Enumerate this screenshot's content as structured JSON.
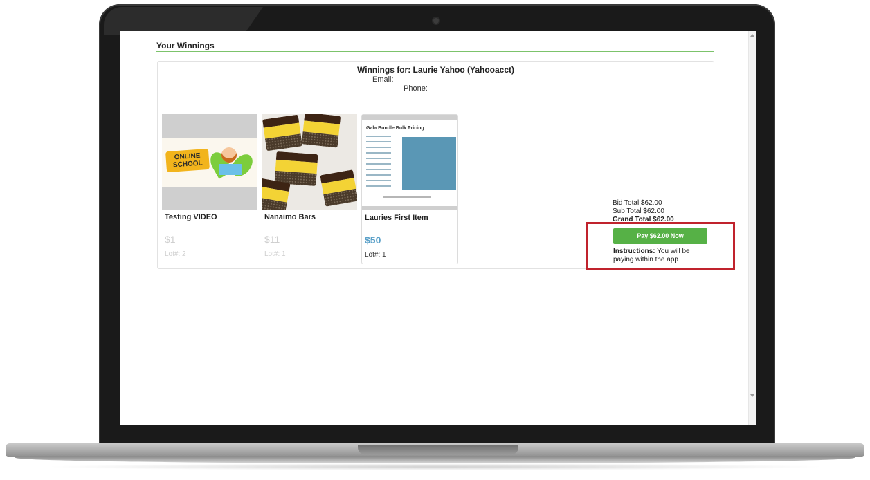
{
  "page": {
    "section_title": "Your Winnings",
    "winner_heading": "Winnings for: Laurie Yahoo (Yahooacct)",
    "email_label": "Email:",
    "phone_label": "Phone:"
  },
  "items": [
    {
      "title": "Testing VIDEO",
      "price": "$1",
      "lot": "Lot#: 2",
      "state": "faded",
      "thumb": "online-school"
    },
    {
      "title": "Nanaimo Bars",
      "price": "$11",
      "lot": "Lot#: 1",
      "state": "faded",
      "thumb": "nanaimo-bars"
    },
    {
      "title": "Lauries First Item",
      "price": "$50",
      "lot": "Lot#: 1",
      "state": "active",
      "thumb": "gala-bundle-pricing"
    }
  ],
  "thumb_text": {
    "school_line1": "ONLINE",
    "school_line2": "SCHOOL",
    "doc_title": "Gala Bundle Bulk Pricing"
  },
  "totals": {
    "bid_total": "Bid Total $62.00",
    "sub_total": "Sub Total $62.00",
    "grand_total": "Grand Total $62.00"
  },
  "payment": {
    "pay_button_label": "Pay $62.00 Now",
    "instructions_label": "Instructions:",
    "instructions_text": "You will be paying within the app"
  },
  "colors": {
    "accent_green": "#56b146",
    "price_blue": "#5aa0c8",
    "highlight_red": "#c0232d",
    "rule_green": "#7cc36b"
  }
}
